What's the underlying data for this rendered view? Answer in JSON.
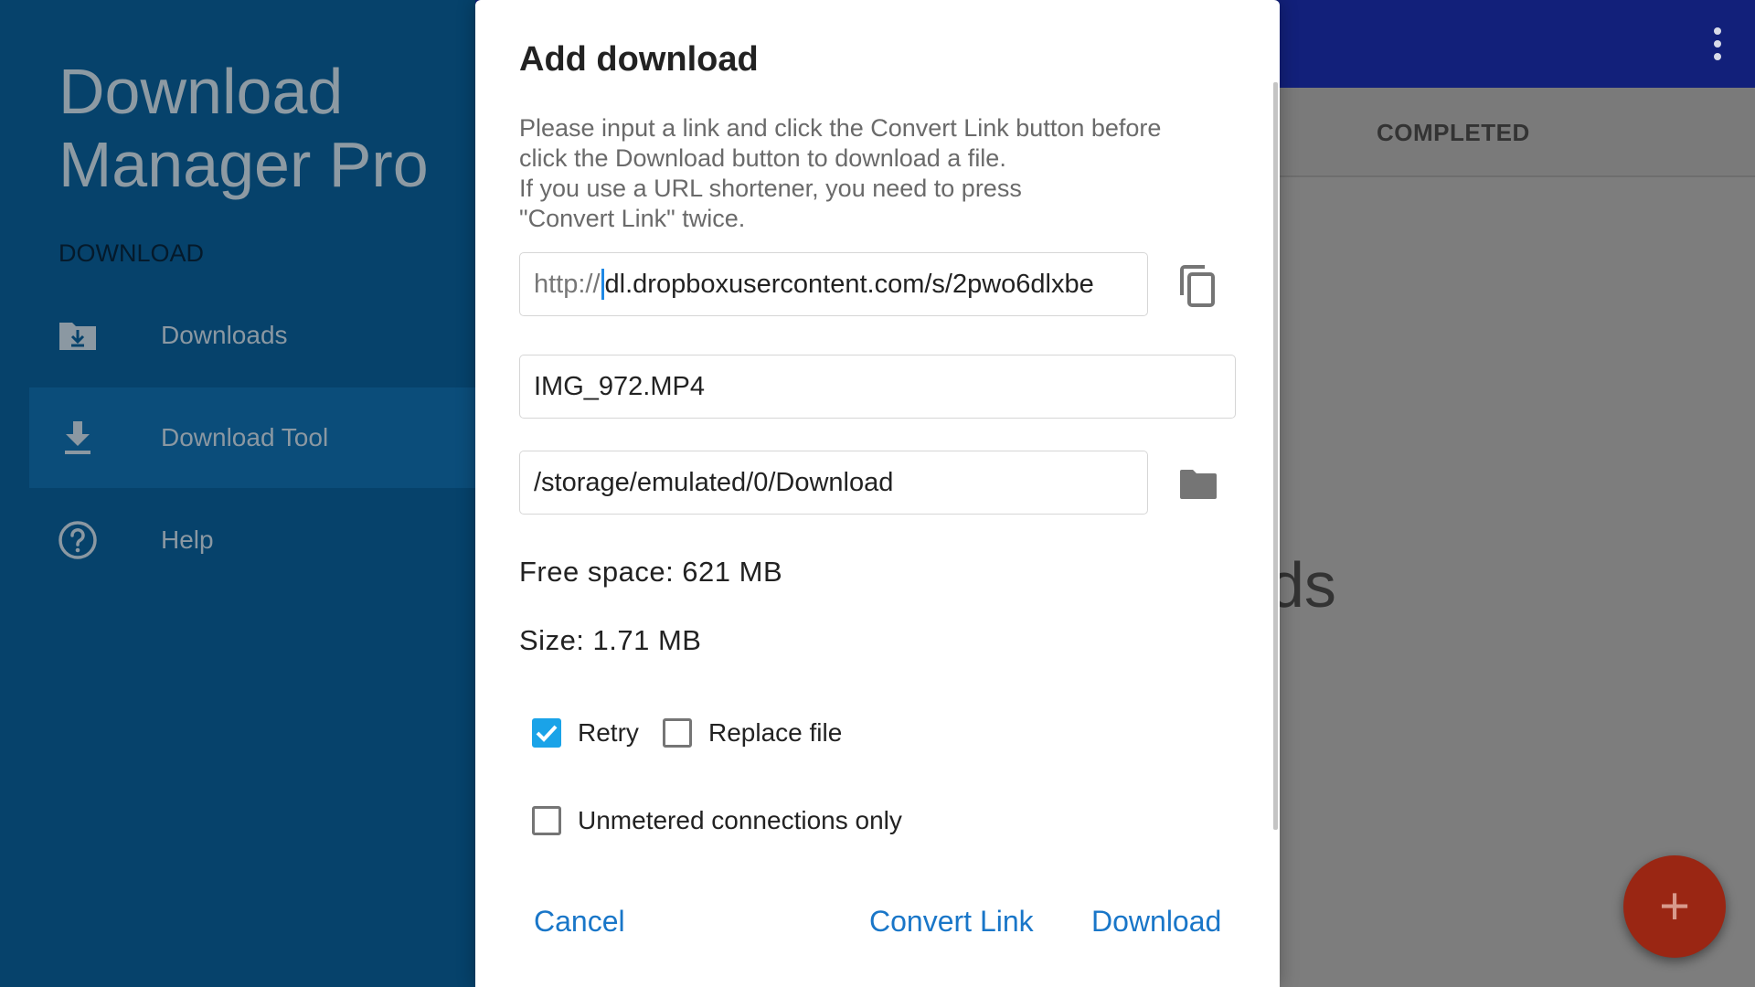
{
  "background": {
    "tabs": {
      "completed": "COMPLETED"
    },
    "empty_text": "ds",
    "fab_icon": "+"
  },
  "drawer": {
    "title": "Download Manager Pro",
    "section": "DOWNLOAD",
    "items": [
      {
        "label": "Downloads",
        "icon": "folder-download-icon"
      },
      {
        "label": "Download Tool",
        "icon": "download-arrow-icon",
        "active": true
      },
      {
        "label": "Help",
        "icon": "help-circle-icon"
      }
    ]
  },
  "dialog": {
    "title": "Add download",
    "description": [
      "Please input a link and click the Convert Link button before",
      "click the Download button to download a file.",
      "If you use a URL shortener, you need to press",
      "\"Convert Link\" twice."
    ],
    "url": {
      "prefix": "http://",
      "value": "dl.dropboxusercontent.com/s/2pwo6dlxbe"
    },
    "filename": "IMG_972.MP4",
    "path": "/storage/emulated/0/Download",
    "free_space": "Free space: 621 MB",
    "size": "Size: 1.71 MB",
    "options": {
      "retry": {
        "label": "Retry",
        "checked": true
      },
      "replace": {
        "label": "Replace file",
        "checked": false
      },
      "unmetered": {
        "label": "Unmetered connections only",
        "checked": false
      }
    },
    "buttons": {
      "cancel": "Cancel",
      "convert": "Convert Link",
      "download": "Download"
    }
  },
  "colors": {
    "accent": "#1976c8",
    "checkbox": "#1aa3e8",
    "toolbar": "#12207a",
    "drawer": "#06426b",
    "fab": "#9a2613"
  }
}
